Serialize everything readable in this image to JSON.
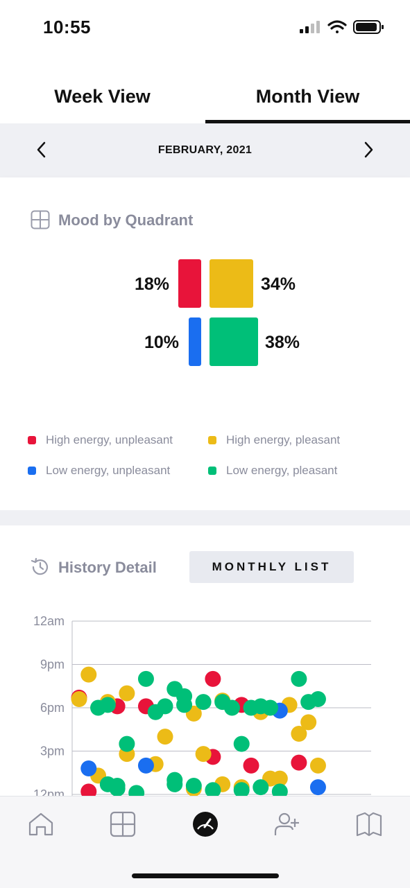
{
  "status_bar": {
    "time": "10:55"
  },
  "tabs": [
    {
      "label": "Week View",
      "active": false
    },
    {
      "label": "Month View",
      "active": true
    }
  ],
  "month_nav": {
    "label": "FEBRUARY, 2021",
    "prev_icon": "chevron-left-icon",
    "next_icon": "chevron-right-icon"
  },
  "mood_section": {
    "title": "Mood by Quadrant",
    "icon": "grid-icon",
    "quadrants": [
      {
        "name": "High energy, unpleasant",
        "percent": "18%",
        "value": 18,
        "color": "#e8143a"
      },
      {
        "name": "High energy, pleasant",
        "percent": "34%",
        "value": 34,
        "color": "#ecbb17"
      },
      {
        "name": "Low energy, unpleasant",
        "percent": "10%",
        "value": 10,
        "color": "#1a6ef0"
      },
      {
        "name": "Low energy, pleasant",
        "percent": "38%",
        "value": 38,
        "color": "#00bf78"
      }
    ]
  },
  "history_section": {
    "title": "History Detail",
    "icon": "history-icon",
    "button": "MONTHLY LIST"
  },
  "chart_data": {
    "type": "scatter",
    "y_ticks": [
      "12am",
      "9pm",
      "6pm",
      "3pm",
      "12pm"
    ],
    "ylim": [
      12,
      24
    ],
    "xlim": [
      1,
      28
    ],
    "grid": true,
    "series": [
      {
        "name": "High energy, unpleasant",
        "color": "#e8143a",
        "points": [
          [
            1,
            18.7
          ],
          [
            2,
            12.2
          ],
          [
            5,
            18.1
          ],
          [
            8,
            18.1
          ],
          [
            15,
            20.0
          ],
          [
            15,
            14.6
          ],
          [
            18,
            18.2
          ],
          [
            19,
            14.0
          ],
          [
            24,
            14.2
          ]
        ]
      },
      {
        "name": "High energy, pleasant",
        "color": "#ecbb17",
        "points": [
          [
            1,
            18.6
          ],
          [
            2,
            20.3
          ],
          [
            3,
            13.3
          ],
          [
            4,
            18.4
          ],
          [
            6,
            19.0
          ],
          [
            6,
            14.8
          ],
          [
            9,
            14.1
          ],
          [
            10,
            16.0
          ],
          [
            13,
            12.4
          ],
          [
            13,
            17.6
          ],
          [
            14,
            14.8
          ],
          [
            16,
            18.5
          ],
          [
            16,
            12.7
          ],
          [
            18,
            12.5
          ],
          [
            20,
            17.7
          ],
          [
            21,
            13.1
          ],
          [
            22,
            13.1
          ],
          [
            23,
            18.2
          ],
          [
            24,
            16.2
          ],
          [
            25,
            17.0
          ],
          [
            26,
            14.0
          ]
        ]
      },
      {
        "name": "Low energy, unpleasant",
        "color": "#1a6ef0",
        "points": [
          [
            2,
            13.8
          ],
          [
            8,
            14.0
          ],
          [
            22,
            17.8
          ],
          [
            26,
            12.5
          ]
        ]
      },
      {
        "name": "Low energy, pleasant",
        "color": "#00bf78",
        "points": [
          [
            3,
            18.0
          ],
          [
            4,
            18.2
          ],
          [
            4,
            12.7
          ],
          [
            5,
            12.6
          ],
          [
            5,
            12.4
          ],
          [
            6,
            15.5
          ],
          [
            7,
            12.1
          ],
          [
            8,
            20.0
          ],
          [
            9,
            17.7
          ],
          [
            10,
            18.1
          ],
          [
            11,
            12.7
          ],
          [
            11,
            19.3
          ],
          [
            11,
            13.0
          ],
          [
            12,
            18.8
          ],
          [
            12,
            18.2
          ],
          [
            13,
            12.6
          ],
          [
            14,
            18.4
          ],
          [
            15,
            12.3
          ],
          [
            16,
            18.4
          ],
          [
            17,
            18.0
          ],
          [
            18,
            12.3
          ],
          [
            18,
            15.5
          ],
          [
            19,
            18.0
          ],
          [
            20,
            18.1
          ],
          [
            20,
            12.5
          ],
          [
            21,
            18.0
          ],
          [
            22,
            12.2
          ],
          [
            24,
            20.0
          ],
          [
            25,
            18.4
          ],
          [
            26,
            18.6
          ]
        ]
      }
    ]
  },
  "bottom_nav": [
    {
      "name": "home-icon"
    },
    {
      "name": "grid-icon"
    },
    {
      "name": "gauge-icon"
    },
    {
      "name": "add-person-icon"
    },
    {
      "name": "journal-icon"
    }
  ]
}
